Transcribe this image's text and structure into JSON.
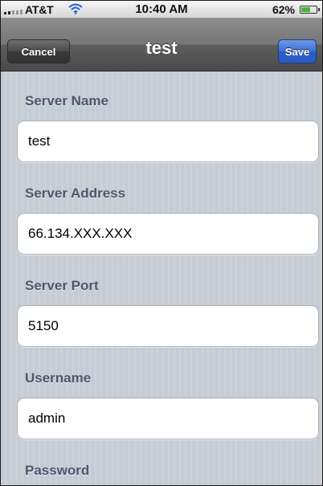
{
  "status_bar": {
    "carrier": "AT&T",
    "time": "10:40 AM",
    "battery_percent": "62%",
    "battery_level": 0.62,
    "wifi_icon": "wifi-icon",
    "signal_icon": "signal-bars-icon",
    "battery_icon": "battery-icon"
  },
  "nav_bar": {
    "title": "test",
    "cancel_label": "Cancel",
    "save_label": "Save",
    "save_color": "#3f6fd7"
  },
  "form": {
    "fields": [
      {
        "label": "Server Name",
        "value": "test"
      },
      {
        "label": "Server Address",
        "value": "66.134.XXX.XXX"
      },
      {
        "label": "Server Port",
        "value": "5150"
      },
      {
        "label": "Username",
        "value": "admin"
      },
      {
        "label": "Password"
      }
    ]
  },
  "colors": {
    "background": "#c5ccd4",
    "label": "#4c566c"
  }
}
